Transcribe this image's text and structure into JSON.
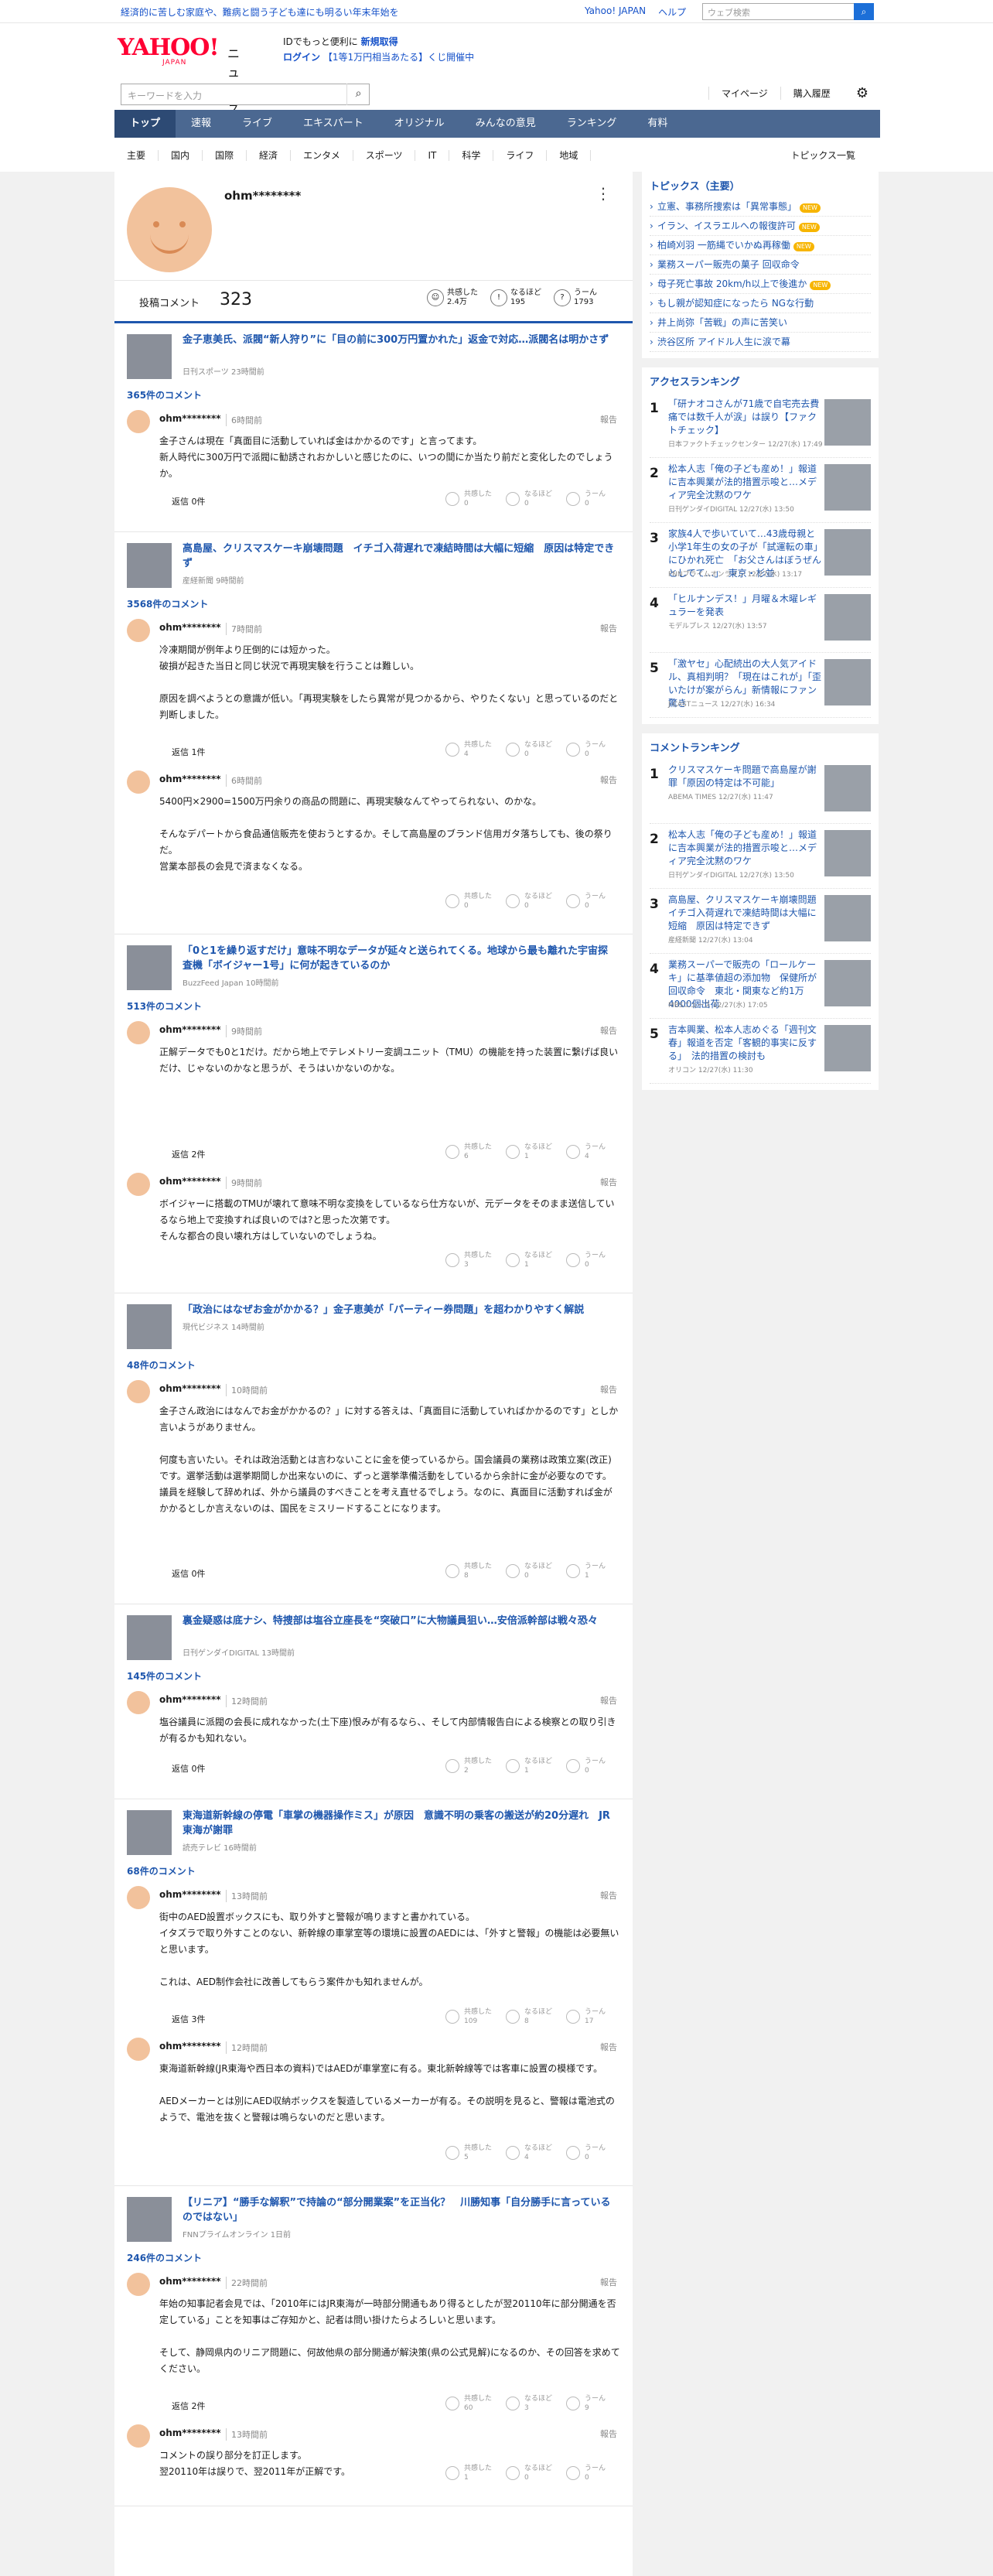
{
  "topbar": {
    "promo": "経済的に苦しむ家庭や、難病と闘う子ども達にも明るい年末年始を",
    "links": [
      "Yahoo! JAPAN",
      "ヘルプ"
    ],
    "search_placeholder": "ウェブ検索"
  },
  "header": {
    "logo": "YAHOO!",
    "logo_sub": "JAPAN",
    "logo_news": "ニュース",
    "login_line1_a": "IDでもっと便利に",
    "login_line1_b": "新規取得",
    "login_line2_a": "ログイン",
    "login_line2_b": "【1等1万円相当あたる】くじ開催中",
    "search_placeholder": "キーワードを入力",
    "links": [
      "マイページ",
      "購入履歴"
    ]
  },
  "gnav": [
    "トップ",
    "速報",
    "ライブ",
    "エキスパート",
    "オリジナル",
    "みんなの意見",
    "ランキング",
    "有料"
  ],
  "snav": [
    "主要",
    "国内",
    "国際",
    "経済",
    "エンタメ",
    "スポーツ",
    "IT",
    "科学",
    "ライフ",
    "地域"
  ],
  "snav_all": "トピックス一覧",
  "profile": {
    "name": "ohm********",
    "label": "投稿コメント",
    "count": "323",
    "reactions": [
      {
        "label": "共感した",
        "value": "2.4万"
      },
      {
        "label": "なるほど",
        "value": "195"
      },
      {
        "label": "うーん",
        "value": "1793"
      }
    ]
  },
  "common": {
    "user": "ohm********",
    "report": "報告",
    "r1": "共感した",
    "r2": "なるほど",
    "r3": "うーん"
  },
  "articles": [
    {
      "title": "金子恵美氏、派閥“新人狩り”に「目の前に300万円置かれた」返金で対応…派閥名は明かさず",
      "src": "日刊スポーツ 23時間前",
      "comments": "365件のコメント",
      "cmts": [
        {
          "time": "6時間前",
          "text": "金子さんは現在「真面目に活動していれば金はかかるのです」と言ってます。\n新人時代に300万円で派閥に勧誘されおかしいと感じたのに、いつの間にか当たり前だと変化したのでしょうか。",
          "reply": "返信 0件",
          "v": [
            "0",
            "0",
            "0"
          ]
        }
      ]
    },
    {
      "title": "高島屋、クリスマスケーキ崩壊問題　イチゴ入荷遅れで凍結時間は大幅に短縮　原因は特定できず",
      "src": "産経新聞 9時間前",
      "comments": "3568件のコメント",
      "cmts": [
        {
          "time": "7時間前",
          "text": "冷凍期間が例年より圧倒的には短かった。\n破損が起きた当日と同じ状況で再現実験を行うことは難しい。\n\n原因を調べようとの意識が低い。「再現実験をしたら異常が見つかるから、やりたくない」と思っているのだと判断しました。",
          "reply": "返信 1件",
          "v": [
            "4",
            "0",
            "0"
          ]
        },
        {
          "time": "6時間前",
          "text": "5400円×2900=1500万円余りの商品の問題に、再現実験なんてやってられない、のかな。\n\nそんなデパートから食品通信販売を使おうとするか。そして高島屋のブランド信用ガタ落ちしても、後の祭りだ。\n営業本部長の会見で済まなくなる。",
          "reply": "",
          "v": [
            "0",
            "0",
            "0"
          ]
        }
      ]
    },
    {
      "title": "「0と1を繰り返すだけ」意味不明なデータが延々と送られてくる。地球から最も離れた宇宙探査機「ボイジャー1号」に何が起きているのか",
      "src": "BuzzFeed Japan 10時間前",
      "comments": "513件のコメント",
      "cmts": [
        {
          "time": "9時間前",
          "text": "正解データでも0と1だけ。だから地上でテレメトリー変調ユニット（TMU）の機能を持った装置に繋げば良いだけ、じゃないのかなと思うが、そうはいかないのかな。",
          "reply": "返信 2件",
          "v": [
            "6",
            "1",
            "4"
          ]
        },
        {
          "time": "9時間前",
          "text": "ボイジャーに搭載のTMUが壊れて意味不明な変換をしているなら仕方ないが、元データをそのまま送信しているなら地上で変換すれば良いのでは?と思った次第です。\nそんな都合の良い壊れ方はしていないのでしょうね。",
          "reply": "",
          "v": [
            "3",
            "1",
            "0"
          ]
        }
      ]
    },
    {
      "title": "「政治にはなぜお金がかかる？」金子恵美が「パーティー券問題」を超わかりやすく解説",
      "src": "現代ビジネス 14時間前",
      "comments": "48件のコメント",
      "cmts": [
        {
          "time": "10時間前",
          "text": "金子さん政治にはなんでお金がかかるの？」に対する答えは、「真面目に活動していればかかるのです」としか言いようがありません。\n\n何度も言いたい。それは政治活動とは言わないことに金を使っているから。国会議員の業務は政策立案(改正)です。選挙活動は選挙期間しか出来ないのに、ずっと選挙準備活動をしているから余計に金が必要なのです。\n議員を経験して辞めれば、外から議員のすべきことを考え直せるでしょう。なのに、真面目に活動すれば金がかかるとしか言えないのは、国民をミスリードすることになります。",
          "reply": "返信 0件",
          "v": [
            "8",
            "0",
            "1"
          ]
        }
      ]
    },
    {
      "title": "裏金疑惑は底ナシ、特捜部は塩谷立座長を“突破口”に大物議員狙い…安倍派幹部は戦々恐々",
      "src": "日刊ゲンダイDIGITAL 13時間前",
      "comments": "145件のコメント",
      "cmts": [
        {
          "time": "12時間前",
          "text": "塩谷議員に派閥の会長に成れなかった(土下座)恨みが有るなら、、そして内部情報告白による検察との取り引きが有るかも知れない。",
          "reply": "返信 0件",
          "v": [
            "2",
            "1",
            "0"
          ]
        }
      ]
    },
    {
      "title": "東海道新幹線の停電「車掌の機器操作ミス」が原因　意識不明の乗客の搬送が約20分遅れ　JR東海が謝罪",
      "src": "読売テレビ 16時間前",
      "comments": "68件のコメント",
      "cmts": [
        {
          "time": "13時間前",
          "text": "街中のAED設置ボックスにも、取り外すと警報が鳴りますと書かれている。\nイタズラで取り外すことのない、新幹線の車掌室等の環境に設置のAEDには、「外すと警報」の機能は必要無いと思います。\n\nこれは、AED制作会社に改善してもらう案件かも知れませんが。",
          "reply": "返信 3件",
          "v": [
            "109",
            "8",
            "17"
          ]
        },
        {
          "time": "12時間前",
          "text": "東海道新幹線(JR東海や西日本の資料)ではAEDが車掌室に有る。東北新幹線等では客車に設置の模様です。\n\nAEDメーカーとは別にAED収納ボックスを製造しているメーカーが有る。その説明を見ると、警報は電池式のようで、電池を抜くと警報は鳴らないのだと思います。",
          "reply": "",
          "v": [
            "5",
            "4",
            "0"
          ]
        }
      ]
    },
    {
      "title": "【リニア】“勝手な解釈”で持論の“部分開業案”を正当化？　川勝知事「自分勝手に言っているのではない」",
      "src": "FNNプライムオンライン 1日前",
      "comments": "246件のコメント",
      "cmts": [
        {
          "time": "22時間前",
          "text": "年始の知事記者会見では、「2010年にはJR東海が一時部分開通もあり得るとしたが翌20110年に部分開通を否定している」ことを知事はご存知かと、記者は問い掛けたらよろしいと思います。\n\nそして、静岡県内のリニア問題に、何故他県の部分開通が解決策(県の公式見解)になるのか、その回答を求めてください。",
          "reply": "返信 2件",
          "v": [
            "60",
            "3",
            "9"
          ]
        },
        {
          "time": "13時間前",
          "text": "コメントの誤り部分を訂正します。\n翌20110年は誤りで、翌2011年が正解です。",
          "reply": "",
          "v": [
            "1",
            "0",
            "0"
          ]
        }
      ]
    }
  ],
  "sidebar": {
    "topics_title": "トピックス（主要）",
    "topics": [
      {
        "t": "立憲、事務所捜索は「異常事態」",
        "n": "NEW"
      },
      {
        "t": "イラン、イスラエルへの報復許可",
        "n": "NEW"
      },
      {
        "t": "柏崎刈羽 一筋縄でいかぬ再稼働",
        "n": "NEW"
      },
      {
        "t": "業務スーパー販売の菓子 回収命令",
        "n": ""
      },
      {
        "t": "母子死亡事故 20km/h以上で後進か",
        "n": "NEW"
      },
      {
        "t": "もし親が認知症になったら NGな行動",
        "n": ""
      },
      {
        "t": "井上尚弥「苦戦」の声に苦笑い",
        "n": ""
      },
      {
        "t": "渋谷区所 アイドル人生に涙で幕",
        "n": ""
      }
    ],
    "access_title": "アクセスランキング",
    "access": [
      {
        "t": "「研ナオコさんが71歳で自宅売去費痛では数千人が涙」は誤り【ファクトチェック】",
        "s": "日本ファクトチェックセンター 12/27(水) 17:49"
      },
      {
        "t": "松本人志「俺の子ども産め！」報道に吉本興業が法的措置示唆と…メディア完全沈黙のワケ",
        "s": "日刊ゲンダイDIGITAL 12/27(水) 13:50"
      },
      {
        "t": "家族4人で歩いていて…43歳母親と小学1年生の女の子が「試運転の車」にひかれ死亡　「お父さんはぼうぜんとしてて…」　東京・杉並",
        "s": "FNNプライムオンライン 12/27(水) 13:17"
      },
      {
        "t": "「ヒルナンデス！」月曜＆木曜レギュラーを発表",
        "s": "モデルプレス 12/27(水) 13:57"
      },
      {
        "t": "「激ヤセ」心配続出の大人気アイドル、真相判明？「現在はこれが」「歪いたけが案がらん」新情報にファン驚き",
        "s": "J-CASTニュース 12/27(水) 16:34"
      }
    ],
    "comment_title": "コメントランキング",
    "comment": [
      {
        "t": "クリスマスケーキ問題で高島屋が謝罪「原因の特定は不可能」",
        "s": "ABEMA TIMES 12/27(水) 11:47"
      },
      {
        "t": "松本人志「俺の子ども産め！」報道に吉本興業が法的措置示唆と…メディア完全沈黙のワケ",
        "s": "日刊ゲンダイDIGITAL 12/27(水) 13:50"
      },
      {
        "t": "高島屋、クリスマスケーキ崩壊問題　イチゴ入荷遅れで凍結時間は大幅に短縮　原因は特定できず",
        "s": "産経新聞 12/27(水) 13:04"
      },
      {
        "t": "業務スーパーで販売の「ロールケーキ」に基準値超の添加物　保健所が回収命令　東北・関東など約1万4000個出荷",
        "s": "MBSニュース 12/27(水) 17:05"
      },
      {
        "t": "吉本興業、松本人志めぐる「週刊文春」報道を否定「客観的事実に反する」　法的措置の検討も",
        "s": "オリコン 12/27(水) 11:30"
      }
    ]
  }
}
